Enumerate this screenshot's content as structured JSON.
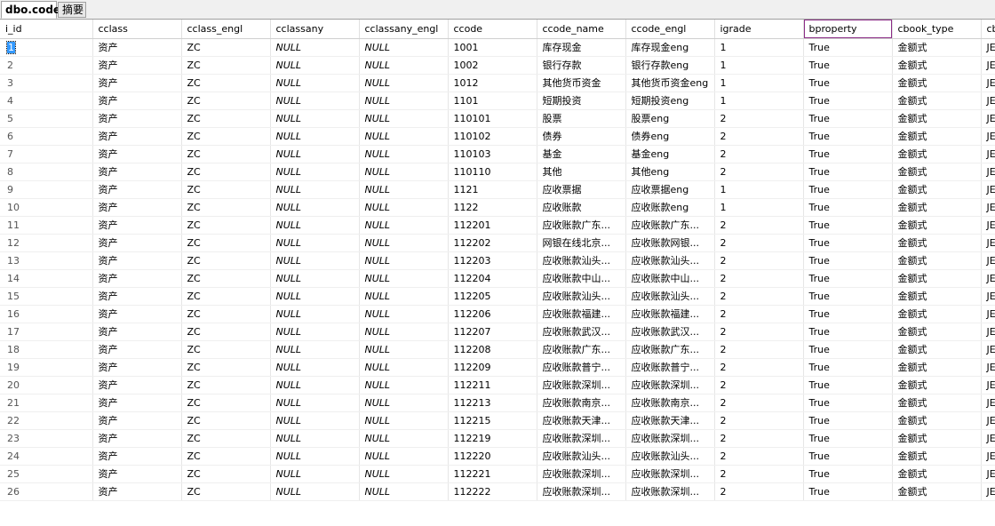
{
  "tabs": [
    {
      "label": "dbo.code",
      "active": true
    },
    {
      "label": "摘要",
      "active": false
    }
  ],
  "columns": [
    "i_id",
    "cclass",
    "cclass_engl",
    "cclassany",
    "cclassany_engl",
    "ccode",
    "ccode_name",
    "ccode_engl",
    "igrade",
    "bproperty",
    "cbook_type",
    "cb"
  ],
  "highlighted_column": "bproperty",
  "selection_color": "#3399ff",
  "highlight_border_color": "#8b2c86",
  "rows": [
    [
      "1",
      "资产",
      "ZC",
      "NULL",
      "NULL",
      "1001",
      "库存现金",
      "库存现金eng",
      "1",
      "True",
      "金额式",
      "JES"
    ],
    [
      "2",
      "资产",
      "ZC",
      "NULL",
      "NULL",
      "1002",
      "银行存款",
      "银行存款eng",
      "1",
      "True",
      "金额式",
      "JES"
    ],
    [
      "3",
      "资产",
      "ZC",
      "NULL",
      "NULL",
      "1012",
      "其他货币资金",
      "其他货币资金eng",
      "1",
      "True",
      "金额式",
      "JES"
    ],
    [
      "4",
      "资产",
      "ZC",
      "NULL",
      "NULL",
      "1101",
      "短期投资",
      "短期投资eng",
      "1",
      "True",
      "金额式",
      "JES"
    ],
    [
      "5",
      "资产",
      "ZC",
      "NULL",
      "NULL",
      "110101",
      "股票",
      "股票eng",
      "2",
      "True",
      "金额式",
      "JES"
    ],
    [
      "6",
      "资产",
      "ZC",
      "NULL",
      "NULL",
      "110102",
      "债券",
      "债券eng",
      "2",
      "True",
      "金额式",
      "JES"
    ],
    [
      "7",
      "资产",
      "ZC",
      "NULL",
      "NULL",
      "110103",
      "基金",
      "基金eng",
      "2",
      "True",
      "金额式",
      "JES"
    ],
    [
      "8",
      "资产",
      "ZC",
      "NULL",
      "NULL",
      "110110",
      "其他",
      "其他eng",
      "2",
      "True",
      "金额式",
      "JES"
    ],
    [
      "9",
      "资产",
      "ZC",
      "NULL",
      "NULL",
      "1121",
      "应收票据",
      "应收票据eng",
      "1",
      "True",
      "金额式",
      "JES"
    ],
    [
      "10",
      "资产",
      "ZC",
      "NULL",
      "NULL",
      "1122",
      "应收账款",
      "应收账款eng",
      "1",
      "True",
      "金额式",
      "JES"
    ],
    [
      "11",
      "资产",
      "ZC",
      "NULL",
      "NULL",
      "112201",
      "应收账款广东...",
      "应收账款广东...",
      "2",
      "True",
      "金额式",
      "JES"
    ],
    [
      "12",
      "资产",
      "ZC",
      "NULL",
      "NULL",
      "112202",
      "网银在线北京...",
      "应收账款网银...",
      "2",
      "True",
      "金额式",
      "JES"
    ],
    [
      "13",
      "资产",
      "ZC",
      "NULL",
      "NULL",
      "112203",
      "应收账款汕头...",
      "应收账款汕头...",
      "2",
      "True",
      "金额式",
      "JES"
    ],
    [
      "14",
      "资产",
      "ZC",
      "NULL",
      "NULL",
      "112204",
      "应收账款中山...",
      "应收账款中山...",
      "2",
      "True",
      "金额式",
      "JES"
    ],
    [
      "15",
      "资产",
      "ZC",
      "NULL",
      "NULL",
      "112205",
      "应收账款汕头...",
      "应收账款汕头...",
      "2",
      "True",
      "金额式",
      "JES"
    ],
    [
      "16",
      "资产",
      "ZC",
      "NULL",
      "NULL",
      "112206",
      "应收账款福建...",
      "应收账款福建...",
      "2",
      "True",
      "金额式",
      "JES"
    ],
    [
      "17",
      "资产",
      "ZC",
      "NULL",
      "NULL",
      "112207",
      "应收账款武汉...",
      "应收账款武汉...",
      "2",
      "True",
      "金额式",
      "JES"
    ],
    [
      "18",
      "资产",
      "ZC",
      "NULL",
      "NULL",
      "112208",
      "应收账款广东...",
      "应收账款广东...",
      "2",
      "True",
      "金额式",
      "JES"
    ],
    [
      "19",
      "资产",
      "ZC",
      "NULL",
      "NULL",
      "112209",
      "应收账款普宁...",
      "应收账款普宁...",
      "2",
      "True",
      "金额式",
      "JES"
    ],
    [
      "20",
      "资产",
      "ZC",
      "NULL",
      "NULL",
      "112211",
      "应收账款深圳...",
      "应收账款深圳...",
      "2",
      "True",
      "金额式",
      "JES"
    ],
    [
      "21",
      "资产",
      "ZC",
      "NULL",
      "NULL",
      "112213",
      "应收账款南京...",
      "应收账款南京...",
      "2",
      "True",
      "金额式",
      "JES"
    ],
    [
      "22",
      "资产",
      "ZC",
      "NULL",
      "NULL",
      "112215",
      "应收账款天津...",
      "应收账款天津...",
      "2",
      "True",
      "金额式",
      "JES"
    ],
    [
      "23",
      "资产",
      "ZC",
      "NULL",
      "NULL",
      "112219",
      "应收账款深圳...",
      "应收账款深圳...",
      "2",
      "True",
      "金额式",
      "JES"
    ],
    [
      "24",
      "资产",
      "ZC",
      "NULL",
      "NULL",
      "112220",
      "应收账款汕头...",
      "应收账款汕头...",
      "2",
      "True",
      "金额式",
      "JES"
    ],
    [
      "25",
      "资产",
      "ZC",
      "NULL",
      "NULL",
      "112221",
      "应收账款深圳...",
      "应收账款深圳...",
      "2",
      "True",
      "金额式",
      "JES"
    ],
    [
      "26",
      "资产",
      "ZC",
      "NULL",
      "NULL",
      "112222",
      "应收账款深圳...",
      "应收账款深圳...",
      "2",
      "True",
      "金额式",
      "JES"
    ]
  ]
}
